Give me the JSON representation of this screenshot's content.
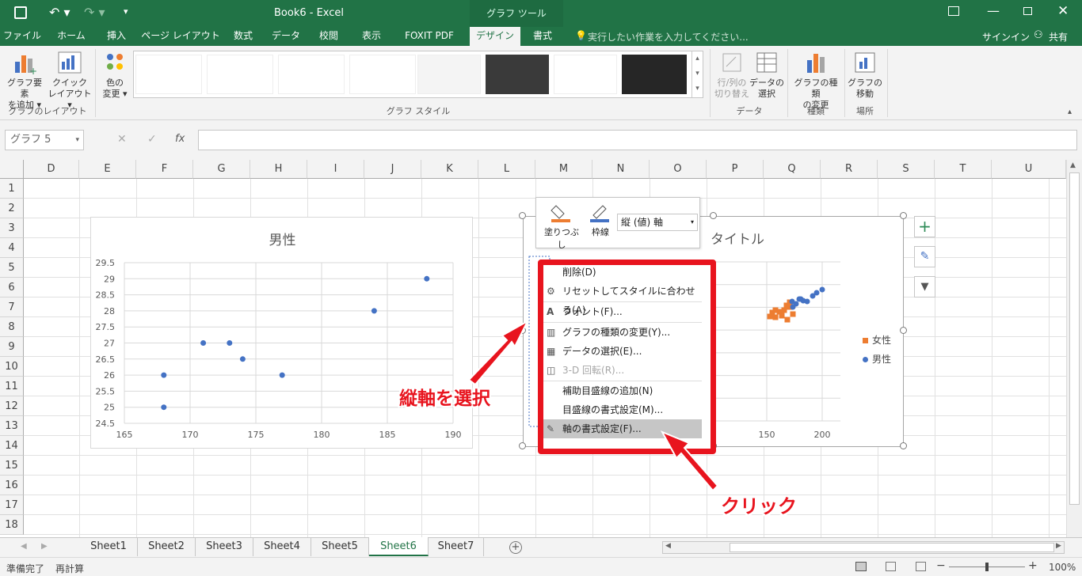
{
  "title": {
    "doc": "Book6 - Excel",
    "tool": "グラフ ツール"
  },
  "tabs": [
    "ファイル",
    "ホーム",
    "挿入",
    "ページ レイアウト",
    "数式",
    "データ",
    "校閲",
    "表示",
    "FOXIT PDF",
    "デザイン",
    "書式"
  ],
  "tellme": "実行したい作業を入力してください...",
  "signin": "サインイン",
  "share": "共有",
  "ribbon": {
    "add_element": [
      "グラフ要素",
      "を追加"
    ],
    "quick_layout": [
      "クイック",
      "レイアウト"
    ],
    "group_layout": "グラフのレイアウト",
    "colors": [
      "色の",
      "変更"
    ],
    "group_styles": "グラフ スタイル",
    "switch": [
      "行/列の",
      "切り替え"
    ],
    "select_data": [
      "データの",
      "選択"
    ],
    "group_data": "データ",
    "change_type": [
      "グラフの種類",
      "の変更"
    ],
    "group_type": "種類",
    "move": [
      "グラフの",
      "移動"
    ],
    "group_location": "場所"
  },
  "namebox": "グラフ 5",
  "fx": "fx",
  "columns": [
    "D",
    "E",
    "F",
    "G",
    "H",
    "I",
    "J",
    "K",
    "L",
    "M",
    "N",
    "O",
    "P",
    "Q",
    "R",
    "S",
    "T",
    "U"
  ],
  "rows": [
    "1",
    "2",
    "3",
    "4",
    "5",
    "6",
    "7",
    "8",
    "9",
    "10",
    "11",
    "12",
    "13",
    "14",
    "15",
    "16",
    "17",
    "18"
  ],
  "chart_data": [
    {
      "type": "scatter",
      "title": "男性",
      "xlim": [
        165,
        190
      ],
      "ylim": [
        24.5,
        29.5
      ],
      "x_ticks": [
        "165",
        "170",
        "175",
        "180",
        "185",
        "190"
      ],
      "y_ticks": [
        "24.5",
        "25",
        "25.5",
        "26",
        "26.5",
        "27",
        "27.5",
        "28",
        "28.5",
        "29",
        "29.5"
      ],
      "series": [
        {
          "name": "男性",
          "color": "#4472c4",
          "x": [
            168,
            168,
            171,
            173,
            174,
            177,
            184,
            188
          ],
          "y": [
            26,
            25,
            27,
            27,
            26.5,
            26,
            28,
            29
          ]
        }
      ]
    },
    {
      "type": "scatter",
      "title": "タイトル",
      "x_ticks": [
        "150",
        "200"
      ],
      "legend": "right",
      "series": [
        {
          "name": "女性",
          "color": "#ed7d31"
        },
        {
          "name": "男性",
          "color": "#4472c4"
        }
      ]
    }
  ],
  "minitoolbar": {
    "fill": "塗りつぶし",
    "outline": "枠線",
    "target": "縦 (値) 軸"
  },
  "context_menu": [
    {
      "label": "削除(D)",
      "enabled": true
    },
    {
      "label": "リセットしてスタイルに合わせる(A)",
      "enabled": true
    },
    {
      "label": "フォント(F)...",
      "enabled": true
    },
    {
      "label": "グラフの種類の変更(Y)...",
      "enabled": true
    },
    {
      "label": "データの選択(E)...",
      "enabled": true
    },
    {
      "label": "3-D 回転(R)...",
      "enabled": false
    },
    {
      "label": "補助目盛線の追加(N)",
      "enabled": true
    },
    {
      "label": "目盛線の書式設定(M)...",
      "enabled": true
    },
    {
      "label": "軸の書式設定(F)...",
      "enabled": true
    }
  ],
  "annotations": {
    "select_axis": "縦軸を選択",
    "click": "クリック"
  },
  "sheets": [
    "Sheet1",
    "Sheet2",
    "Sheet3",
    "Sheet4",
    "Sheet5",
    "Sheet6",
    "Sheet7"
  ],
  "active_sheet": "Sheet6",
  "status": {
    "ready": "準備完了",
    "recalc": "再計算",
    "zoom": "100%"
  }
}
